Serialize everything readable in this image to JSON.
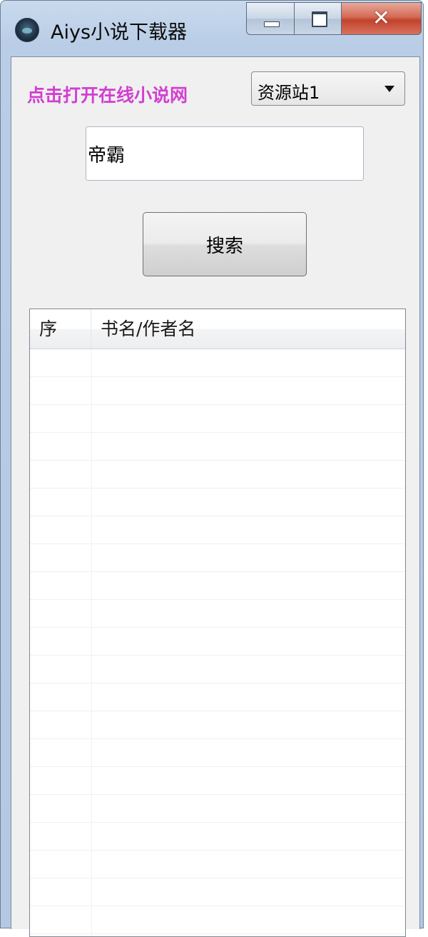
{
  "window": {
    "title": "Aiys小说下载器",
    "close_glyph": "✕"
  },
  "main": {
    "open_link_label": "点击打开在线小说网",
    "source_select": {
      "selected": "资源站1"
    },
    "search_input": {
      "value": "帝霸",
      "placeholder": ""
    },
    "search_button_label": "搜索"
  },
  "results": {
    "columns": [
      "序",
      "书名/作者名"
    ],
    "rows": []
  },
  "icons": {
    "app": "app-icon",
    "minimize": "minimize-icon",
    "maximize": "maximize-icon",
    "close": "close-icon",
    "dropdown": "chevron-down-icon"
  }
}
